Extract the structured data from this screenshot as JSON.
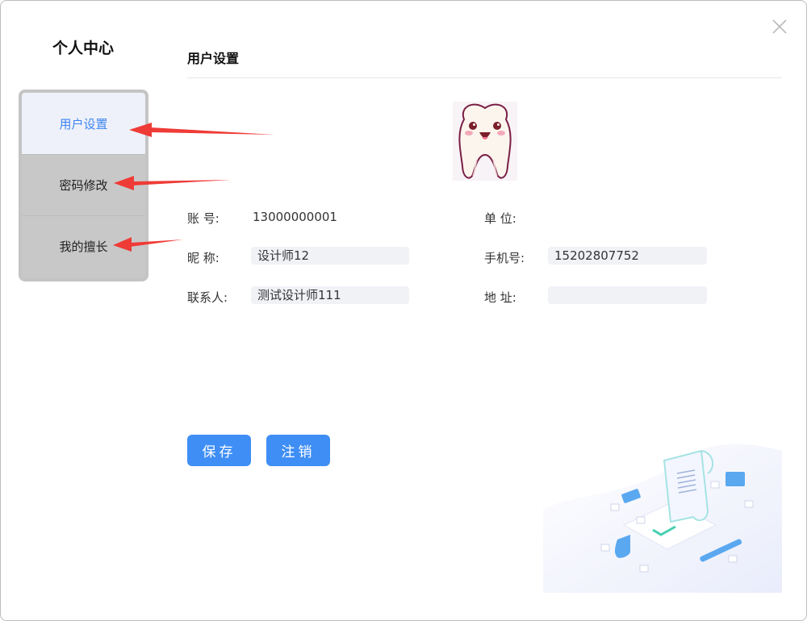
{
  "side": {
    "title": "个人中心"
  },
  "menu": [
    {
      "label": "用户设置",
      "active": true
    },
    {
      "label": "密码修改",
      "active": false
    },
    {
      "label": "我的擅长",
      "active": false
    }
  ],
  "main": {
    "title": "用户设置",
    "fields": {
      "account": {
        "label": "账  号:",
        "value": "13000000001"
      },
      "unit": {
        "label": "单  位:",
        "value": ""
      },
      "nickname": {
        "label": "昵  称:",
        "value": "设计师12"
      },
      "phone": {
        "label": "手机号:",
        "value": "15202807752"
      },
      "contact": {
        "label": "联系人:",
        "value": "测试设计师111"
      },
      "address": {
        "label": "地  址:",
        "value": ""
      }
    },
    "buttons": {
      "save": "保存",
      "logout": "注销"
    }
  },
  "colors": {
    "accent": "#3f8ef5",
    "active_menu_text": "#3f85f0",
    "arrow": "#ef3b36"
  }
}
